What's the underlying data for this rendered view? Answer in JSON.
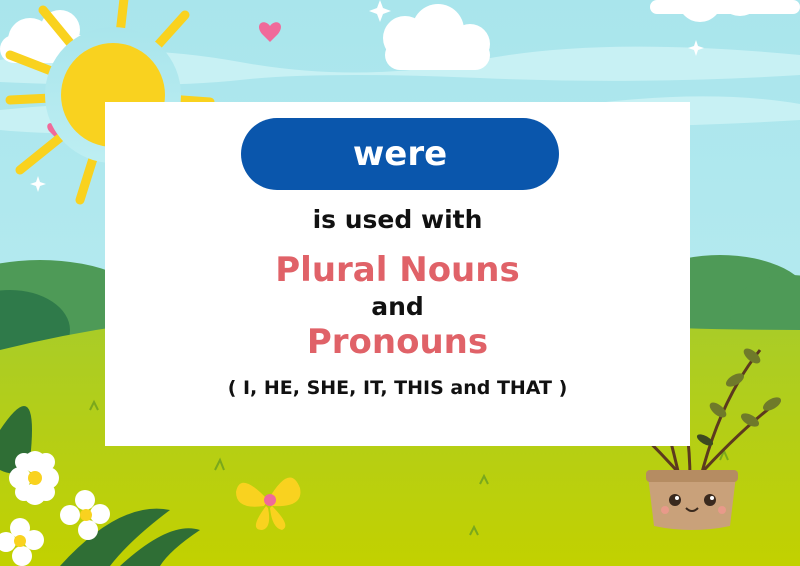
{
  "verb": "were",
  "line_used_with": "is used with",
  "term_plural_nouns": "Plural Nouns",
  "conjunction": "and",
  "term_pronouns": "Pronouns",
  "pronoun_list": "( I, HE, SHE, IT, THIS and THAT )",
  "colors": {
    "pill": "#0a56ac",
    "highlight_text": "#e06268",
    "sky": "#a9e5ec",
    "grass": "#a8cc2a",
    "sun": "#f9d21f"
  }
}
